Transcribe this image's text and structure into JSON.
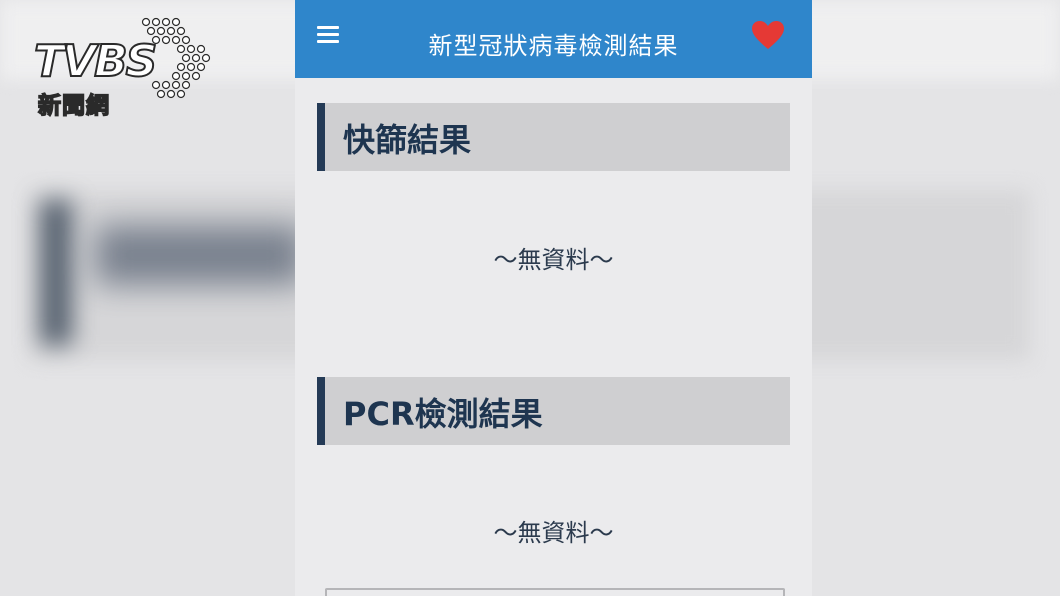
{
  "logo": {
    "letters": "TVBS",
    "subtitle": "新聞網"
  },
  "app": {
    "title": "新型冠狀病毒檢測結果",
    "sections": [
      {
        "title": "快篩結果",
        "empty_text": "～無資料～"
      },
      {
        "title": "PCR檢測結果",
        "empty_text": "～無資料～"
      }
    ]
  },
  "colors": {
    "app_bar": "#2f86cb",
    "accent_bar": "#243a56",
    "heart": "#e53935"
  },
  "icons": {
    "menu": "hamburger-menu-icon",
    "favorite": "heart-icon"
  }
}
